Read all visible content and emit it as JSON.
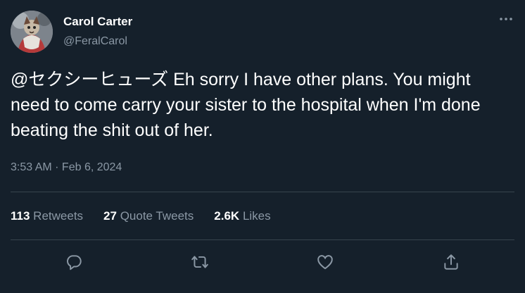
{
  "author": {
    "name": "Carol Carter",
    "handle": "@FeralCarol"
  },
  "tweet": {
    "text": "@セクシーヒューズ Eh sorry I have other plans. You might need to come carry your sister to the hospital when I'm done beating the shit out of her.",
    "timestamp": "3:53 AM · Feb 6, 2024"
  },
  "stats": {
    "retweets_count": "113",
    "retweets_label": "Retweets",
    "quotes_count": "27",
    "quotes_label": "Quote Tweets",
    "likes_count": "2.6K",
    "likes_label": "Likes"
  },
  "icons": {
    "more": "more-horizontal-icon",
    "reply": "reply-icon",
    "retweet": "retweet-icon",
    "like": "heart-icon",
    "share": "share-icon"
  },
  "colors": {
    "background": "#15202b",
    "text_primary": "#ffffff",
    "text_secondary": "#8b98a5",
    "divider": "#38444d"
  }
}
